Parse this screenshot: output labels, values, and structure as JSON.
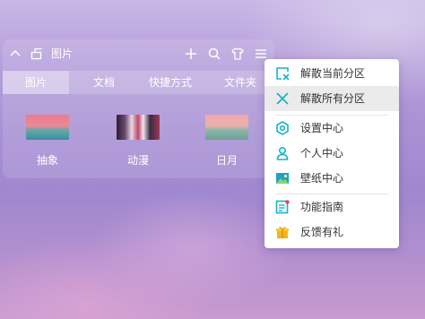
{
  "panel": {
    "title": "图片",
    "tabs": [
      {
        "label": "图片",
        "active": true
      },
      {
        "label": "文档",
        "active": false
      },
      {
        "label": "快捷方式",
        "active": false
      },
      {
        "label": "文件夹",
        "active": false
      }
    ],
    "files": [
      {
        "label": "抽象",
        "icon": "abstract-wallpaper-thumbnail"
      },
      {
        "label": "动漫",
        "icon": "anime-wallpaper-thumbnail"
      },
      {
        "label": "日月",
        "icon": "sun-moon-wallpaper-thumbnail"
      }
    ]
  },
  "menu": {
    "items": [
      {
        "label": "解散当前分区",
        "icon": "dissolve-current-icon"
      },
      {
        "label": "解散所有分区",
        "icon": "close-x-icon",
        "highlighted": true
      },
      {
        "label": "设置中心",
        "icon": "settings-icon"
      },
      {
        "label": "个人中心",
        "icon": "user-icon"
      },
      {
        "label": "壁纸中心",
        "icon": "wallpaper-icon"
      },
      {
        "label": "功能指南",
        "icon": "guide-icon"
      },
      {
        "label": "反馈有礼",
        "icon": "gift-icon"
      }
    ]
  },
  "colors": {
    "accent": "#16b3c9",
    "menu_bg": "#ffffff",
    "menu_hover": "#ebebeb"
  }
}
